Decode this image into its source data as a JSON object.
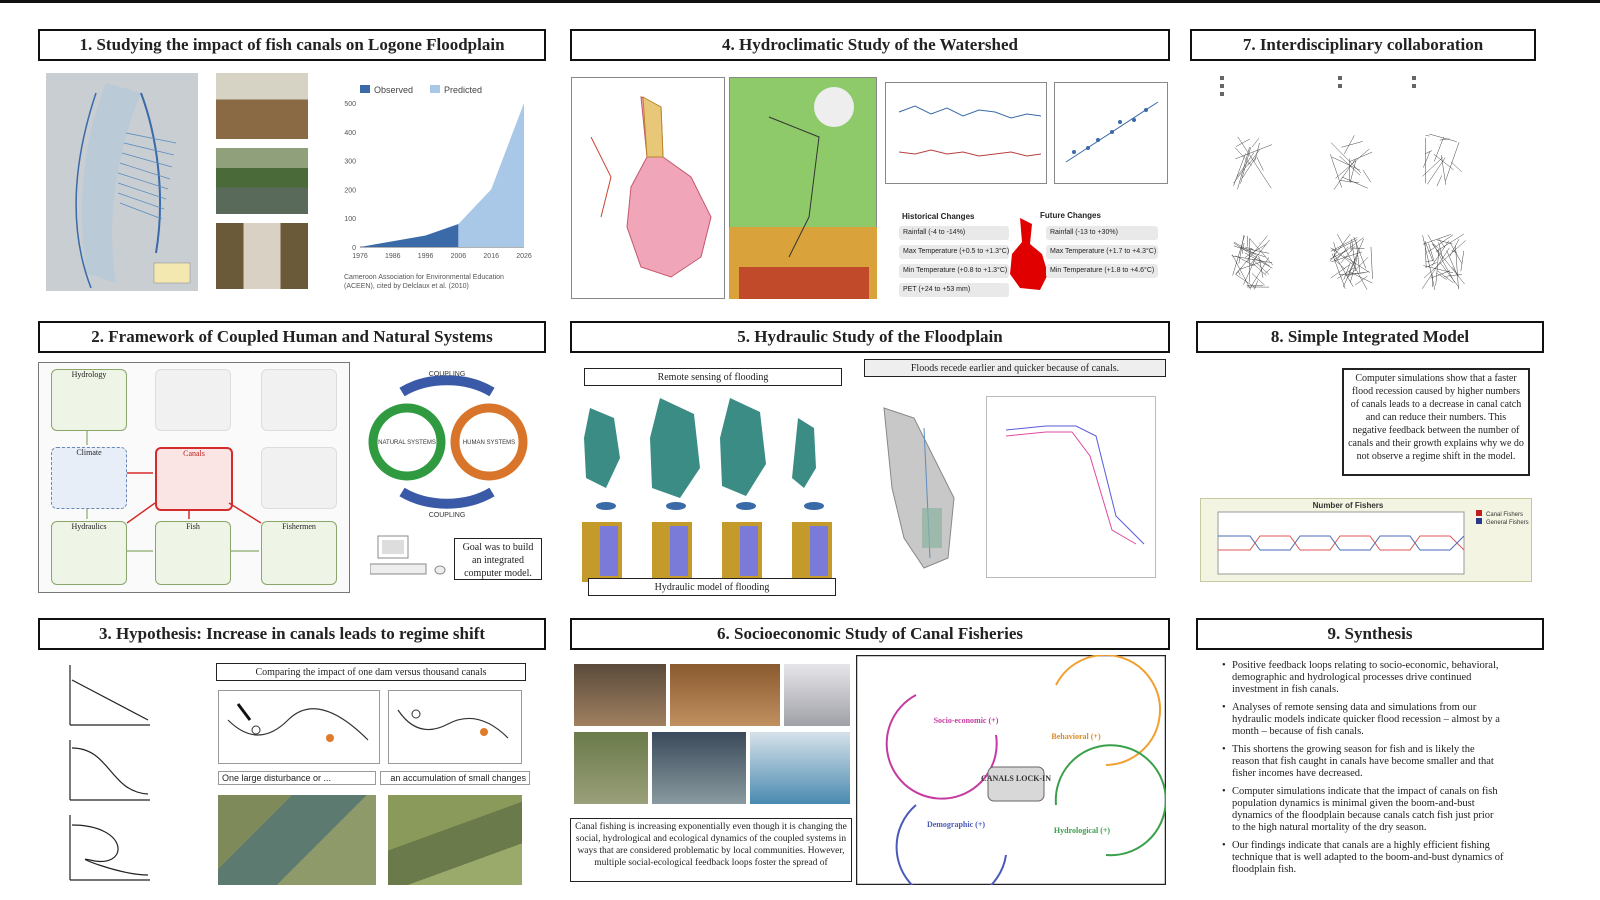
{
  "sections": {
    "s1": "1. Studying the impact of fish canals on Logone Floodplain",
    "s2": "2. Framework of Coupled Human and Natural Systems",
    "s3": "3. Hypothesis: Increase in canals leads to regime shift",
    "s4": "4. Hydroclimatic Study of the Watershed",
    "s5": "5. Hydraulic Study of the Floodplain",
    "s6": "6. Socioeconomic Study of Canal Fisheries",
    "s7": "7. Interdisciplinary collaboration",
    "s8": "8. Simple Integrated Model",
    "s9": "9. Synthesis"
  },
  "s1": {
    "legend_observed": "Observed",
    "legend_predicted": "Predicted",
    "source": "Cameroon Association for Environmental Education (ACEEN), cited by Delclaux et al. (2010)"
  },
  "chart_data": {
    "type": "area",
    "x": [
      1976,
      1986,
      1996,
      2006,
      2016,
      2026
    ],
    "series": [
      {
        "name": "Observed",
        "values": [
          0,
          20,
          40,
          80,
          null,
          null
        ]
      },
      {
        "name": "Predicted",
        "values": [
          null,
          null,
          null,
          80,
          200,
          500
        ]
      }
    ],
    "ylim": [
      0,
      500
    ],
    "yticks": [
      "0",
      "100",
      "200",
      "300",
      "400",
      "500"
    ],
    "xticks": [
      "1976",
      "1986",
      "1996",
      "2006",
      "2016",
      "2026"
    ],
    "colors": {
      "Observed": "#3a6aa8",
      "Predicted": "#a9c8e8"
    }
  },
  "s2": {
    "nodes": {
      "hydrology": "Hydrology",
      "climate": "Climate",
      "canals": "Canals",
      "hydraulics": "Hydraulics",
      "fish": "Fish",
      "fishermen": "Fishermen"
    },
    "coupling_top": "COUPLING",
    "coupling_bottom": "COUPLING",
    "natural": "NATURAL SYSTEMS",
    "human": "HUMAN SYSTEMS",
    "goal": "Goal was to build an integrated computer model."
  },
  "s3": {
    "caption_top": "Comparing the impact of one dam versus thousand canals",
    "one_large": "One large disturbance or ...",
    "accumulation": "an accumulation of small changes"
  },
  "s4": {
    "hist_title": "Historical Changes",
    "hist_rows": [
      "Rainfall (-4 to -14%)",
      "Max Temperature (+0.5 to +1.3°C)",
      "Min Temperature (+0.8 to +1.3°C)",
      "PET (+24 to +53 mm)"
    ],
    "fut_title": "Future Changes",
    "fut_rows": [
      "Rainfall (-13 to +30%)",
      "Max Temperature (+1.7 to +4.3°C)",
      "Min Temperature (+1.8 to +4.6°C)"
    ]
  },
  "s5": {
    "remote": "Remote sensing of flooding",
    "hydraulic": "Hydraulic model of flooding",
    "recede": "Floods recede earlier and quicker because of canals."
  },
  "s6": {
    "caption": "Canal fishing is increasing exponentially even though it is changing the social, hydrological and ecological dynamics of the coupled systems in ways that are considered problematic by local communities. However, multiple social-ecological feedback loops foster the spread of",
    "lockin": "CANALS LOCK-IN",
    "socio": "Socio-economic (+)",
    "behavioral": "Behavioral (+)",
    "demographic": "Demographic (+)",
    "hydrological": "Hydrological (+)"
  },
  "s8": {
    "text": "Computer simulations show that a faster flood recession caused by higher numbers of canals leads to a decrease in canal catch and can reduce their numbers. This negative feedback between the number of canals and their growth explains why we do not observe a regime shift in the model.",
    "chart_title": "Number of Fishers",
    "legend_canal": "Canal Fishers",
    "legend_general": "General Fishers"
  },
  "s9": {
    "bullets": [
      "Positive feedback loops relating to socio-economic, behavioral, demographic and hydrological processes drive continued investment in fish canals.",
      "Analyses of remote sensing data and simulations from our hydraulic models indicate quicker flood recession – almost by a month – because of fish canals.",
      "This shortens the growing season for fish and is likely the reason that fish caught in canals have become smaller and that fisher incomes have decreased.",
      "Computer simulations indicate that the impact of canals on fish population dynamics is minimal given the boom-and-bust dynamics of the floodplain because canals catch fish just prior to the high natural mortality of the dry season.",
      "Our findings indicate that canals are a highly efficient fishing technique that is well adapted to the boom-and-bust dynamics of floodplain fish."
    ]
  }
}
